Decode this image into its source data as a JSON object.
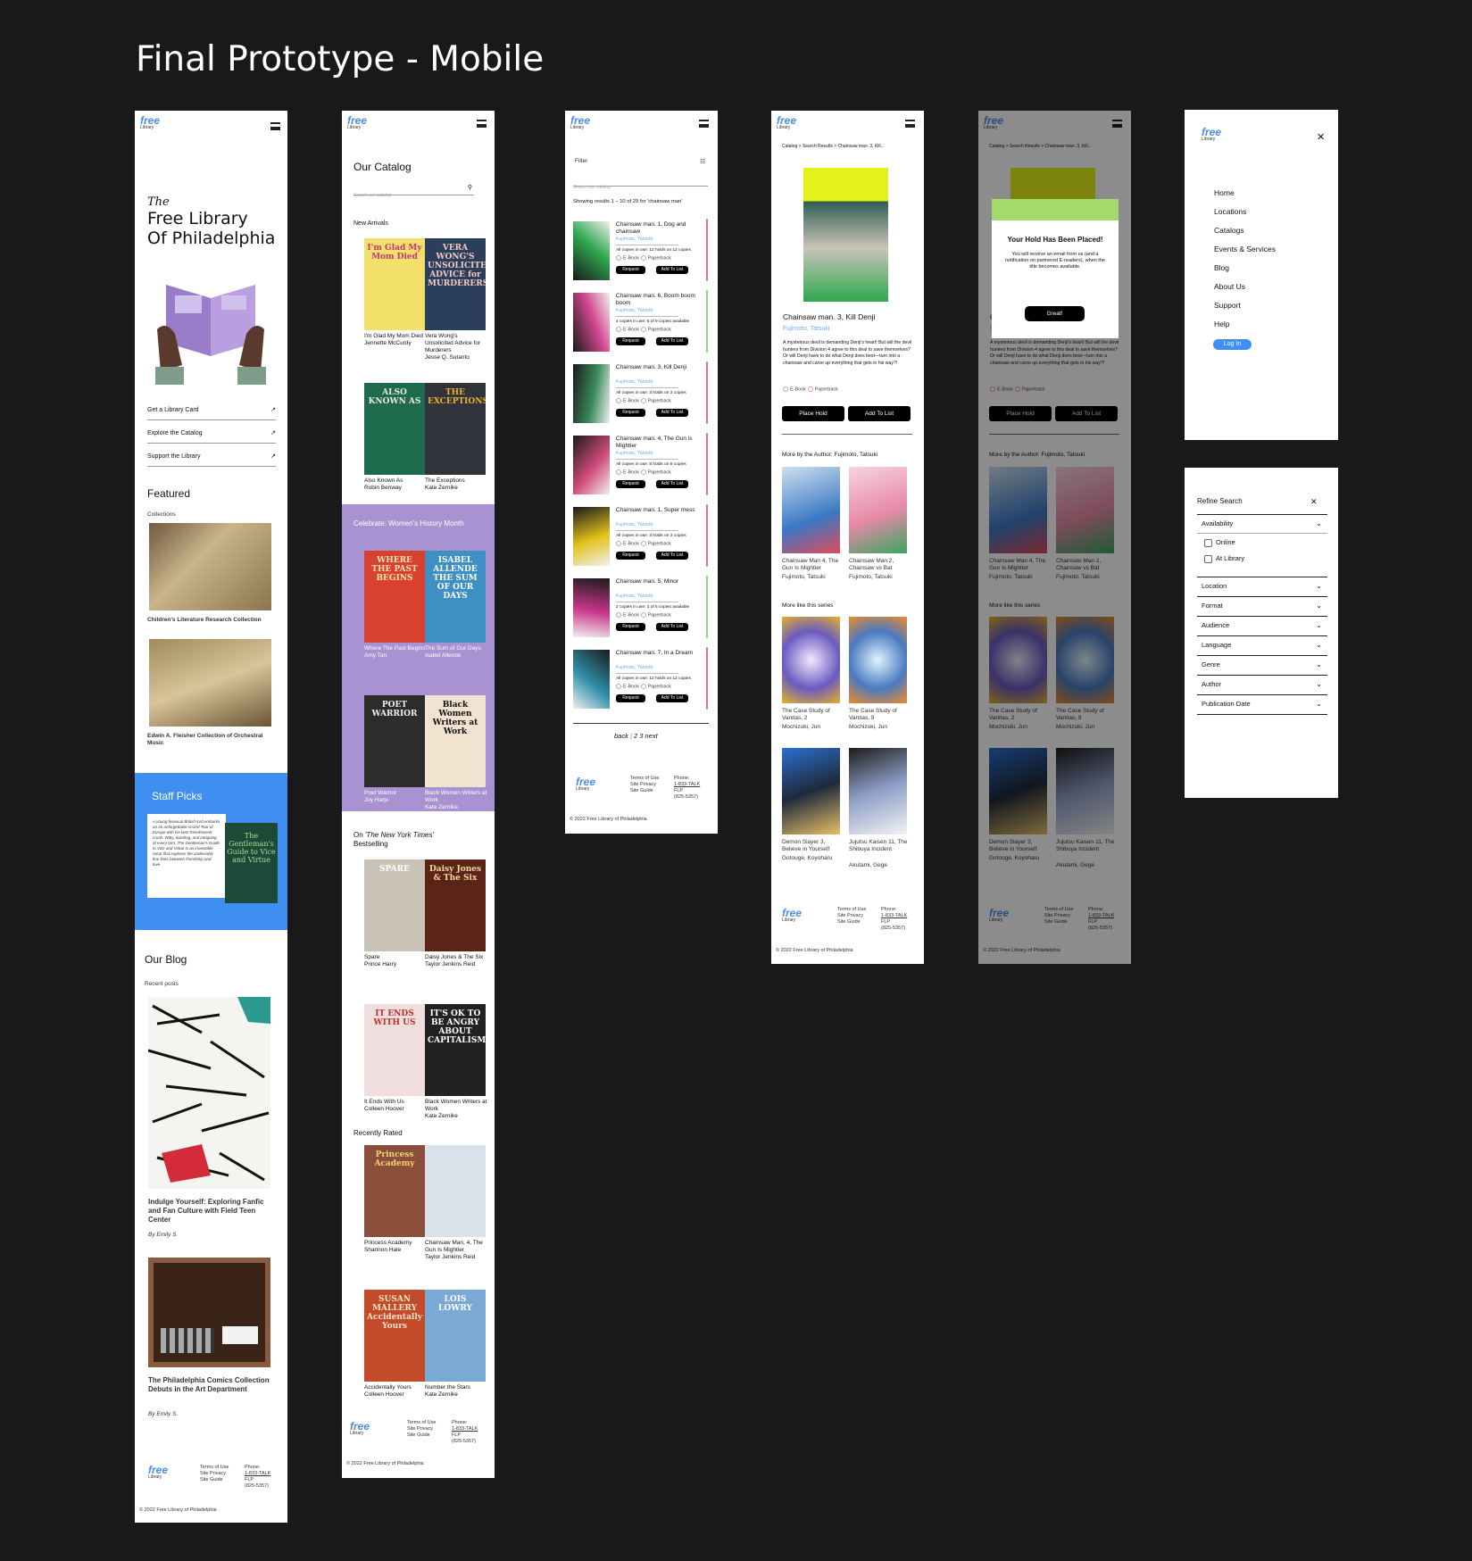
{
  "page_title": "Final Prototype - Mobile",
  "brand": {
    "logo_main": "free",
    "logo_sub": "Library",
    "logo_small": "of Philadelphia"
  },
  "home": {
    "hero_the": "The",
    "hero_line1": "Free Library",
    "hero_line2": "Of Philadelphia",
    "links": [
      "Get a Library Card",
      "Explore the Catalog",
      "Support the Library"
    ],
    "featured": "Featured",
    "collections": "Collections",
    "collection1": "Children's Literature Research Collection",
    "collection2": "Edwin A. Fleisher Collection of Orchestral Music",
    "staff_picks": "Staff Picks",
    "staff_blurb": "A young bisexual British lord embarks on an unforgettable Grand Tour of Europe with his best friend/secret crush. Witty, dazzling, and intriguing at every turn, The Gentleman's Guide to Vice and Virtue is an irresistible romp that explores the undeniably fine lines between friendship and love.",
    "staff_book": "The Gentleman's Guide to Vice and Virtue",
    "blog": "Our Blog",
    "recent": "Recent posts",
    "post1": "Indulge Yourself: Exploring Fanfic and Fan Culture with Field Teen Center",
    "post1_by": "By Emily S.",
    "post2": "The Philadelphia Comics Collection Debuts in the Art Department",
    "post2_by": "By Emily S."
  },
  "footer": {
    "terms": "Terms of Use",
    "privacy": "Site Privacy",
    "guide": "Site Guide",
    "phone_label": "Phone:",
    "phone": "1-833-TALK",
    "phone2": "FLP",
    "phone3": "(825-5357)",
    "copyright": "© 2022 Free Library of Philadelphia"
  },
  "catalog": {
    "title": "Our Catalog",
    "search_placeholder": "Search our catalog",
    "new_arrivals": "New Arrivals",
    "na": [
      {
        "t": "I'm Glad My Mom Died",
        "a": "Jennette McCurdy",
        "cover": "I'm Glad My Mom Died",
        "bg": "#f3e06a",
        "fg": "#c2367a"
      },
      {
        "t": "Vera Wong's Unsolicited Advice for Murderers",
        "a": "Jesse Q. Sutanto",
        "cover": "VERA WONG'S UNSOLICITED ADVICE for MURDERERS",
        "bg": "#2b3f5c",
        "fg": "#f4c9c0"
      },
      {
        "t": "Also Known As",
        "a": "Robin Benway",
        "cover": "ALSO KNOWN AS",
        "bg": "#1d6b4c",
        "fg": "#e8e8e8"
      },
      {
        "t": "The Exceptions",
        "a": "Kate Zernike",
        "cover": "THE EXCEPTIONS",
        "bg": "#30343a",
        "fg": "#e9b233"
      }
    ],
    "womens": "Celebrate: Women's History Month",
    "wh": [
      {
        "t": "Where The Past Begins",
        "a": "Amy Tan",
        "cover": "WHERE THE PAST BEGINS",
        "bg": "#d8402f",
        "fg": "#fbe8b0"
      },
      {
        "t": "The Sum of Our Days",
        "a": "Isabel Allende",
        "cover": "ISABEL ALLENDE THE SUM OF OUR DAYS",
        "bg": "#3d8fc4",
        "fg": "#ffffff"
      },
      {
        "t": "Poet Warrior",
        "a": "Joy Harjo",
        "cover": "POET WARRIOR",
        "bg": "#2c2c2c",
        "fg": "#f0f0f0"
      },
      {
        "t": "Black Women Writers at Work",
        "a": "Kate Zernike",
        "cover": "Black Women Writers at Work",
        "bg": "#f2e3d0",
        "fg": "#111111"
      }
    ],
    "nyt_prefix": "On ",
    "nyt_name": "'The New York Times'",
    "nyt_suffix": "Bestselling",
    "nyt": [
      {
        "t": "Spare",
        "a": "Prince Harry",
        "cover": "SPARE",
        "bg": "#c9c3b7",
        "fg": "#ffffff"
      },
      {
        "t": "Daisy Jones & The Six",
        "a": "Taylor Jenkins Reid",
        "cover": "Daisy Jones & The Six",
        "bg": "#5b2416",
        "fg": "#f3d9a0"
      },
      {
        "t": "It Ends With Us",
        "a": "Colleen Hoover",
        "cover": "IT ENDS WITH US",
        "bg": "#f0dede",
        "fg": "#b8302e"
      },
      {
        "t": "Black Women Writers at Work",
        "a": "Kate Zernike",
        "cover": "IT'S OK TO BE ANGRY ABOUT CAPITALISM",
        "bg": "#222222",
        "fg": "#ffffff"
      }
    ],
    "rated": "Recently Rated",
    "rr": [
      {
        "t": "Princess Academy",
        "a": "Shannon Hale",
        "cover": "Princess Academy",
        "bg": "#8a4e3a",
        "fg": "#f4d27a"
      },
      {
        "t": "Chainsaw Man, 4, The Gun Is Mightier",
        "a": "Taylor Jenkins Reid",
        "cover": "",
        "bg": "#d9e1ea",
        "fg": "#111"
      },
      {
        "t": "Accidentally Yours",
        "a": "Colleen Hoover",
        "cover": "SUSAN MALLERY Accidentally Yours",
        "bg": "#c44b2a",
        "fg": "#fbe6c8"
      },
      {
        "t": "Number the Stars",
        "a": "Kate Zernike",
        "cover": "LOIS LOWRY",
        "bg": "#7ba9d6",
        "fg": "#ffffff"
      }
    ]
  },
  "results": {
    "filter": "Filter",
    "search_placeholder": "Search our catalog",
    "showing": "Showing results 1 – 10 of 29 for 'chainsaw man'",
    "request": "Request",
    "add": "Add To List",
    "ebook": "E-Book",
    "paperback": "Paperback",
    "author": "Fujimoto, Tatsuki",
    "items": [
      {
        "t": "Chainsaw man. 1, Dog and chainsaw",
        "avail": "All copies in use: 12 holds on 12 copies",
        "bar": "#e07a7a"
      },
      {
        "t": "Chainsaw man. 6, Boom boom boom",
        "avail": "4 copies in use: 5 of 9 copies available",
        "bar": "#8fd97e"
      },
      {
        "t": "Chainsaw man. 3, Kill Denji",
        "avail": "All copies in use: 3 holds on 3 copies",
        "bar": "#e07a7a"
      },
      {
        "t": "Chainsaw man. 4, The Gun is Mightier",
        "avail": "All copies in use: 8 holds on 8 copies",
        "bar": "#e07a7a"
      },
      {
        "t": "Chainsaw man. 1, Super mess",
        "avail": "All copies in use: 3 holds on 3 copies",
        "bar": "#e07a7a"
      },
      {
        "t": "Chainsaw man. 5, Minor",
        "avail": "2 copies in use: 3 of 5 copies available",
        "bar": "#8fd97e"
      },
      {
        "t": "Chainsaw man. 7, In a Dream",
        "avail": "All copies in use: 12 holds on 12 copies",
        "bar": "#e07a7a"
      }
    ],
    "back": "back",
    "sep": "|",
    "pages": "2 3",
    "next": "next"
  },
  "detail": {
    "crumb": "Catalog > Search Results > Chainsaw man. 3, Kill...",
    "title": "Chainsaw man. 3, Kill Denji",
    "author": "Fujimoto, Tatsuki",
    "desc": "A mysterious devil is demanding Denji's heart! But will the devil hunters from Division 4 agree to this deal to save themselves? Or will Denji have to do what Denji does best—turn into a chainsaw and carve up everything that gets in his way?!",
    "ebook": "E-Book",
    "paperback": "Paperback",
    "place_hold": "Place Hold",
    "add": "Add To List",
    "more_author": "More by the Author: Fujimoto, Tatsuki",
    "ma": [
      {
        "t": "Chainsaw Man 4, The Gun Is Mightier",
        "a": "Fujimoto, Tatsuki"
      },
      {
        "t": "Chainsaw Man 2, Chainsaw vs Bat",
        "a": "Fujimoto, Tatsuki"
      }
    ],
    "more_series": "More like this series",
    "ms": [
      {
        "t": "The Case Study of Vanitas, 2",
        "a": "Mochizuki, Jun"
      },
      {
        "t": "The Case Study of Vanitas, 9",
        "a": "Mochizuki, Jun"
      },
      {
        "t": "Demon Slayer 3, Believe in Yourself",
        "a": "Gotouge, Koyoharu"
      },
      {
        "t": "Jujutsu Kaisen 11, The Shibuya Incident",
        "a": "Akutami, Gege"
      }
    ]
  },
  "modal": {
    "title": "Your Hold Has Been Placed!",
    "text": "You will receive an email from us (and a notification on partnered E-readers), when the title becomes available.",
    "button": "Great!"
  },
  "menu": {
    "items": [
      "Home",
      "Locations",
      "Catalogs",
      "Events & Services",
      "Blog",
      "About Us",
      "Support",
      "Help"
    ],
    "login": "Log In"
  },
  "refine": {
    "title": "Refine Search",
    "availability": "Availability",
    "online": "Online",
    "at_library": "At Library",
    "facets": [
      "Location",
      "Format",
      "Audience",
      "Language",
      "Genre",
      "Author",
      "Publication Date"
    ]
  },
  "colors": {
    "bg": "#191919",
    "purple": "#a892d2",
    "blue": "#3e8ff0",
    "link": "#7aa8e8",
    "green": "#a4d96c"
  }
}
